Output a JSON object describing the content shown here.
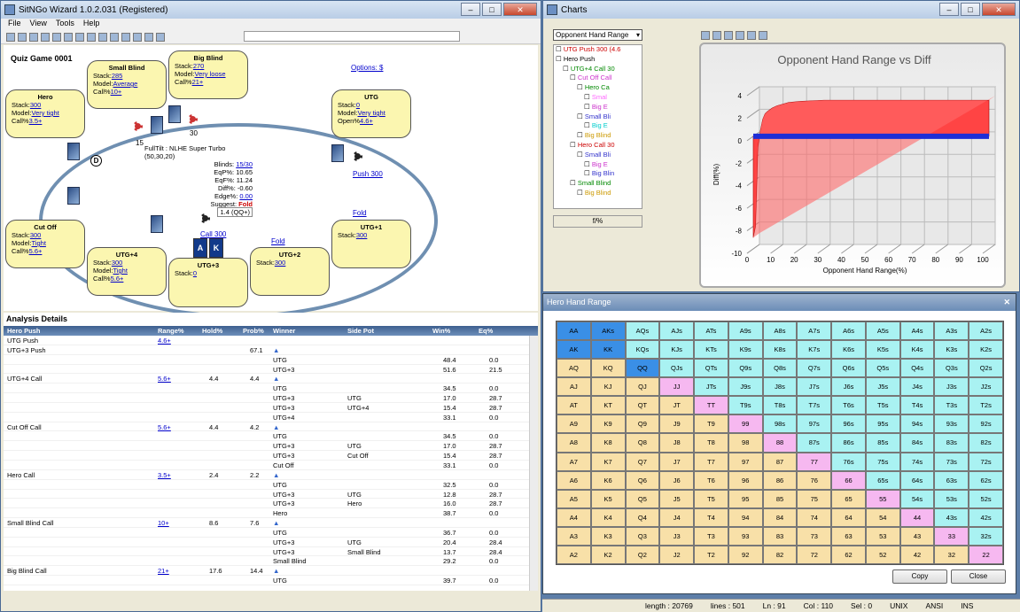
{
  "main": {
    "title": "SitNGo Wizard 1.0.2.031 (Registered)",
    "menu": [
      "File",
      "View",
      "Tools",
      "Help"
    ]
  },
  "table": {
    "game": "Quiz Game 0001",
    "options": "Options: $",
    "seats": [
      {
        "name": "Small Blind",
        "stack": "285",
        "model": "Average",
        "call": "10+",
        "l3": "Call%"
      },
      {
        "name": "Big Blind",
        "stack": "270",
        "model": "Very loose",
        "call": "21+",
        "l3": "Call%"
      },
      {
        "name": "Hero",
        "stack": "300",
        "model": "Very tight",
        "call": "3.5+",
        "l3": "Call%"
      },
      {
        "name": "UTG",
        "stack": "0",
        "model": "Very tight",
        "call": "4.6+",
        "l3": "Open%"
      },
      {
        "name": "Cut Off",
        "stack": "300",
        "model": "Tight",
        "call": "5.6+",
        "l3": "Call%"
      },
      {
        "name": "UTG+4",
        "stack": "300",
        "model": "Tight",
        "call": "5.6+",
        "l3": "Call%"
      },
      {
        "name": "UTG+3",
        "stack": "0"
      },
      {
        "name": "UTG+2",
        "stack": "300"
      },
      {
        "name": "UTG+1",
        "stack": "300"
      }
    ],
    "info": {
      "l1": "FullTilt : NLHE Super Turbo (50,30,20)",
      "blinds": "15/30",
      "eqp": "10.65",
      "eqf": "11.24",
      "diff": "-0.60",
      "edge": "0.00",
      "suggest": "Fold",
      "hand": "1.4 (QQ+)"
    },
    "chip15": "15",
    "chip30": "30",
    "push": "Push 300",
    "call": "Call 300",
    "fold1": "Fold",
    "fold2": "Fold",
    "d": "D",
    "cards": "A K"
  },
  "analysis": {
    "title": "Analysis Details",
    "cols": [
      "Hero Push",
      "Range%",
      "Hold%",
      "Prob%",
      "Winner",
      "Side Pot",
      "Win%",
      "Eq%"
    ],
    "rows": [
      [
        "UTG Push",
        "4.6+",
        "",
        "",
        "",
        "",
        "",
        ""
      ],
      [
        "UTG+3 Push",
        "",
        "",
        "67.1",
        "▲",
        "",
        "",
        ""
      ],
      [
        "",
        "",
        "",
        "",
        "UTG",
        "",
        "48.4",
        "0.0"
      ],
      [
        "",
        "",
        "",
        "",
        "UTG+3",
        "",
        "51.6",
        "21.5"
      ],
      [
        "UTG+4 Call",
        "5.6+",
        "4.4",
        "4.4",
        "▲",
        "",
        "",
        ""
      ],
      [
        "",
        "",
        "",
        "",
        "UTG",
        "",
        "34.5",
        "0.0"
      ],
      [
        "",
        "",
        "",
        "",
        "UTG+3",
        "UTG",
        "17.0",
        "28.7"
      ],
      [
        "",
        "",
        "",
        "",
        "UTG+3",
        "UTG+4",
        "15.4",
        "28.7"
      ],
      [
        "",
        "",
        "",
        "",
        "UTG+4",
        "",
        "33.1",
        "0.0"
      ],
      [
        "Cut Off Call",
        "5.6+",
        "4.4",
        "4.2",
        "▲",
        "",
        "",
        ""
      ],
      [
        "",
        "",
        "",
        "",
        "UTG",
        "",
        "34.5",
        "0.0"
      ],
      [
        "",
        "",
        "",
        "",
        "UTG+3",
        "UTG",
        "17.0",
        "28.7"
      ],
      [
        "",
        "",
        "",
        "",
        "UTG+3",
        "Cut Off",
        "15.4",
        "28.7"
      ],
      [
        "",
        "",
        "",
        "",
        "Cut Off",
        "",
        "33.1",
        "0.0"
      ],
      [
        "Hero Call",
        "3.5+",
        "2.4",
        "2.2",
        "▲",
        "",
        "",
        ""
      ],
      [
        "",
        "",
        "",
        "",
        "UTG",
        "",
        "32.5",
        "0.0"
      ],
      [
        "",
        "",
        "",
        "",
        "UTG+3",
        "UTG",
        "12.8",
        "28.7"
      ],
      [
        "",
        "",
        "",
        "",
        "UTG+3",
        "Hero",
        "16.0",
        "28.7"
      ],
      [
        "",
        "",
        "",
        "",
        "Hero",
        "",
        "38.7",
        "0.0"
      ],
      [
        "Small Blind Call",
        "10+",
        "8.6",
        "7.6",
        "▲",
        "",
        "",
        ""
      ],
      [
        "",
        "",
        "",
        "",
        "UTG",
        "",
        "36.7",
        "0.0"
      ],
      [
        "",
        "",
        "",
        "",
        "UTG+3",
        "UTG",
        "20.4",
        "28.4"
      ],
      [
        "",
        "",
        "",
        "",
        "UTG+3",
        "Small Blind",
        "13.7",
        "28.4"
      ],
      [
        "",
        "",
        "",
        "",
        "Small Blind",
        "",
        "29.2",
        "0.0"
      ],
      [
        "Big Blind Call",
        "21+",
        "17.6",
        "14.4",
        "▲",
        "",
        "",
        ""
      ],
      [
        "",
        "",
        "",
        "",
        "UTG",
        "",
        "39.7",
        "0.0"
      ]
    ]
  },
  "charts": {
    "title": "Charts",
    "select": "Opponent Hand Range",
    "pct": "f/%",
    "tree": [
      "UTG Push 300 (4.6",
      "Hero Push",
      "UTG+4 Call 30",
      "Cut Off Call",
      "Hero Ca",
      "Smal",
      "Big E",
      "Small Bli",
      "Big E",
      "Big Blind",
      "Hero Call 30",
      "Small Bli",
      "Big E",
      "Big Blin",
      "Small Blind",
      "Big Blind"
    ],
    "chart_data": {
      "type": "area",
      "title": "Opponent Hand Range vs Diff",
      "xlabel": "Opponent Hand Range(%)",
      "ylabel": "Diff(%)",
      "xlim": [
        0,
        100
      ],
      "ylim": [
        -10,
        4
      ],
      "x": [
        0,
        1,
        2,
        3,
        4,
        5,
        6,
        8,
        10,
        15,
        20,
        30,
        40,
        60,
        80,
        100
      ],
      "series": [
        {
          "values": [
            -9,
            -8,
            -1,
            0.5,
            1.5,
            2,
            2.2,
            2.5,
            2.7,
            3,
            3.1,
            3.2,
            3.2,
            3.2,
            3.2,
            3.2
          ]
        },
        {
          "values": [
            0,
            0,
            0,
            0,
            0,
            0,
            0,
            0,
            0,
            0,
            0,
            0,
            0,
            0,
            0,
            0
          ]
        }
      ],
      "xticks": [
        "0",
        "10",
        "20",
        "30",
        "40",
        "50",
        "60",
        "70",
        "80",
        "90",
        "100"
      ],
      "yticks": [
        "4",
        "2",
        "0",
        "-2",
        "-4",
        "-6",
        "-8",
        "-10"
      ]
    }
  },
  "hhr": {
    "title": "Hero Hand Range",
    "copy": "Copy",
    "close": "Close",
    "grid": [
      [
        "AA",
        "AKs",
        "AQs",
        "AJs",
        "ATs",
        "A9s",
        "A8s",
        "A7s",
        "A6s",
        "A5s",
        "A4s",
        "A3s",
        "A2s"
      ],
      [
        "AK",
        "KK",
        "KQs",
        "KJs",
        "KTs",
        "K9s",
        "K8s",
        "K7s",
        "K6s",
        "K5s",
        "K4s",
        "K3s",
        "K2s"
      ],
      [
        "AQ",
        "KQ",
        "QQ",
        "QJs",
        "QTs",
        "Q9s",
        "Q8s",
        "Q7s",
        "Q6s",
        "Q5s",
        "Q4s",
        "Q3s",
        "Q2s"
      ],
      [
        "AJ",
        "KJ",
        "QJ",
        "JJ",
        "JTs",
        "J9s",
        "J8s",
        "J7s",
        "J6s",
        "J5s",
        "J4s",
        "J3s",
        "J2s"
      ],
      [
        "AT",
        "KT",
        "QT",
        "JT",
        "TT",
        "T9s",
        "T8s",
        "T7s",
        "T6s",
        "T5s",
        "T4s",
        "T3s",
        "T2s"
      ],
      [
        "A9",
        "K9",
        "Q9",
        "J9",
        "T9",
        "99",
        "98s",
        "97s",
        "96s",
        "95s",
        "94s",
        "93s",
        "92s"
      ],
      [
        "A8",
        "K8",
        "Q8",
        "J8",
        "T8",
        "98",
        "88",
        "87s",
        "86s",
        "85s",
        "84s",
        "83s",
        "82s"
      ],
      [
        "A7",
        "K7",
        "Q7",
        "J7",
        "T7",
        "97",
        "87",
        "77",
        "76s",
        "75s",
        "74s",
        "73s",
        "72s"
      ],
      [
        "A6",
        "K6",
        "Q6",
        "J6",
        "T6",
        "96",
        "86",
        "76",
        "66",
        "65s",
        "64s",
        "63s",
        "62s"
      ],
      [
        "A5",
        "K5",
        "Q5",
        "J5",
        "T5",
        "95",
        "85",
        "75",
        "65",
        "55",
        "54s",
        "53s",
        "52s"
      ],
      [
        "A4",
        "K4",
        "Q4",
        "J4",
        "T4",
        "94",
        "84",
        "74",
        "64",
        "54",
        "44",
        "43s",
        "42s"
      ],
      [
        "A3",
        "K3",
        "Q3",
        "J3",
        "T3",
        "93",
        "83",
        "73",
        "63",
        "53",
        "43",
        "33",
        "32s"
      ],
      [
        "A2",
        "K2",
        "Q2",
        "J2",
        "T2",
        "92",
        "82",
        "72",
        "62",
        "52",
        "42",
        "32",
        "22"
      ]
    ],
    "colors": {
      "selected": "#3a8fe6",
      "pair": "#f6b8f0",
      "suited": "#a9f2f2",
      "offsuit": "#f8e0a8"
    }
  },
  "status": [
    "length : 20769",
    "lines : 501",
    "Ln : 91",
    "Col : 110",
    "Sel : 0",
    "UNIX",
    "ANSI",
    "INS"
  ]
}
